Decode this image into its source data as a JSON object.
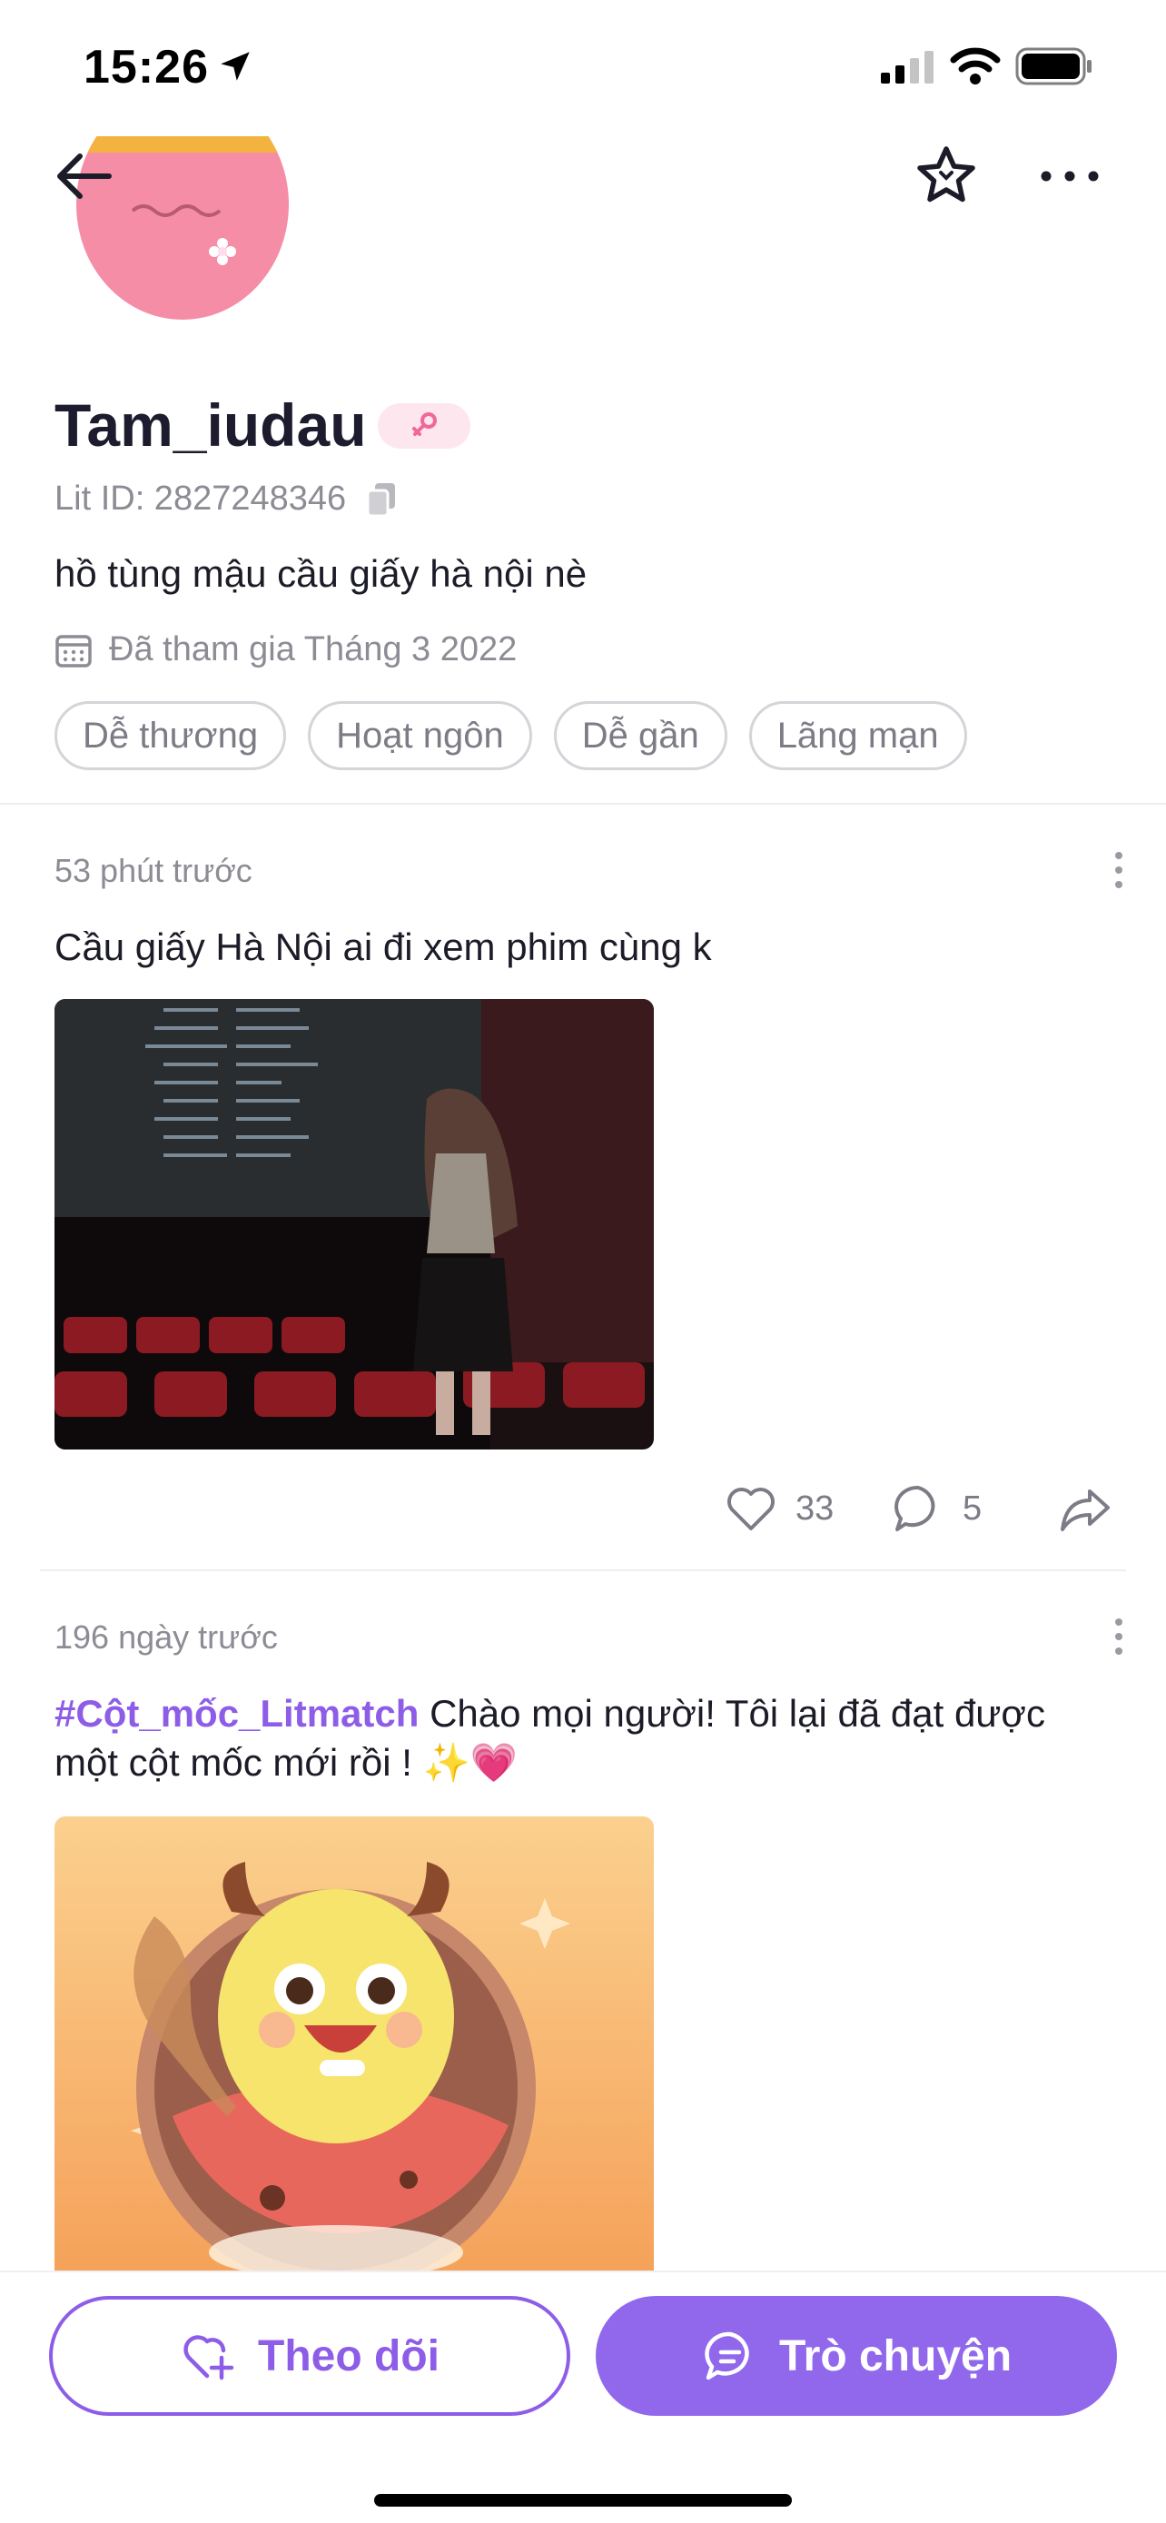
{
  "status_bar": {
    "time": "15:26"
  },
  "nav": {
    "back_icon": "arrow-left-icon",
    "favorite_icon": "star-icon",
    "more_icon": "more-horizontal-icon"
  },
  "profile": {
    "username": "Tam_iudau",
    "gender_icon": "female-icon",
    "lit_id": "Lit ID: 2827248346",
    "bio": "hồ tùng mậu cầu giấy hà nội nè",
    "joined": "Đã tham gia Tháng 3 2022",
    "tags": [
      "Dễ thương",
      "Hoạt ngôn",
      "Dễ gần",
      "Lãng mạn"
    ]
  },
  "posts": [
    {
      "time": "53 phút trước",
      "text": "Cầu giấy Hà Nội ai đi xem phim cùng k",
      "likes": "33",
      "comments": "5"
    },
    {
      "time": "196 ngày trước",
      "hashtag": "#Cột_mốc_Litmatch",
      "text": " Chào mọi người! Tôi lại đã đạt được một cột mốc mới rồi ! ✨💗"
    }
  ],
  "bottom_bar": {
    "follow_label": "Theo dõi",
    "chat_label": "Trò chuyện"
  },
  "colors": {
    "accent": "#8e5de8",
    "chat_button": "#9168ec",
    "text": "#1c1c28",
    "muted": "#8c8c95"
  }
}
